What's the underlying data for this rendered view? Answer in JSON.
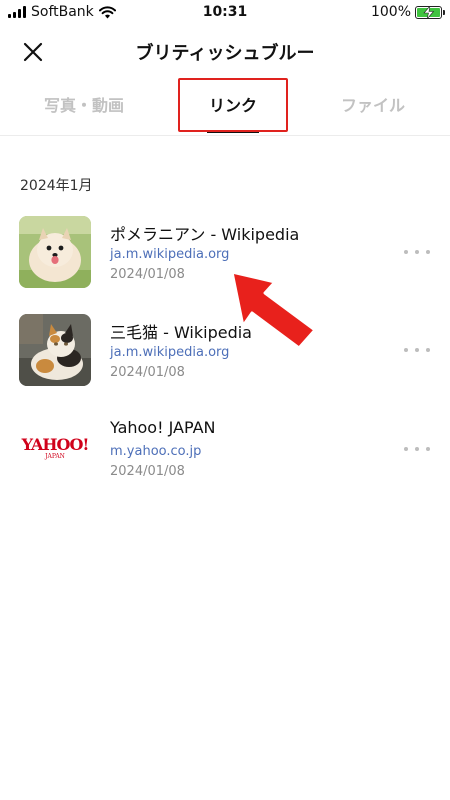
{
  "status_bar": {
    "carrier": "SoftBank",
    "time": "10:31",
    "battery": "100%"
  },
  "header": {
    "title": "ブリティッシュブルー",
    "close_icon": "close-icon"
  },
  "tabs": [
    {
      "label": "写真・動画",
      "active": false
    },
    {
      "label": "リンク",
      "active": true
    },
    {
      "label": "ファイル",
      "active": false
    }
  ],
  "section": {
    "header": "2024年1月"
  },
  "links": [
    {
      "title": "ポメラニアン - Wikipedia",
      "domain": "ja.m.wikipedia.org",
      "date": "2024/01/08",
      "thumbnail": "pomeranian-dog-photo"
    },
    {
      "title": "三毛猫 - Wikipedia",
      "domain": "ja.m.wikipedia.org",
      "date": "2024/01/08",
      "thumbnail": "calico-cat-photo"
    },
    {
      "title": "Yahoo! JAPAN",
      "domain": "m.yahoo.co.jp",
      "date": "2024/01/08",
      "thumbnail": "yahoo-japan-logo",
      "logo_text": "YAHOO!",
      "logo_subtext": "JAPAN"
    }
  ],
  "colors": {
    "highlight": "#e0221e",
    "link_domain": "#4d6fb8",
    "arrow": "#e8211c",
    "battery_fill": "#3fc33f"
  }
}
